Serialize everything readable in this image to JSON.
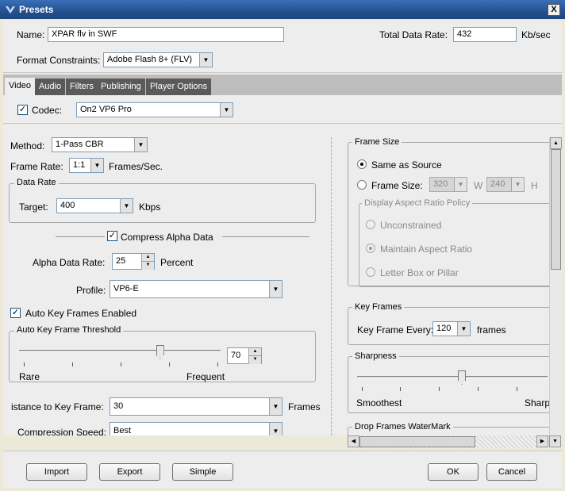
{
  "window": {
    "title": "Presets",
    "close_label": "X"
  },
  "top": {
    "name_label": "Name:",
    "name_value": "XPAR flv in SWF",
    "rate_label": "Total Data Rate:",
    "rate_value": "432",
    "rate_unit": "Kb/sec",
    "format_label": "Format Constraints:",
    "format_value": "Adobe Flash 8+ (FLV)"
  },
  "tabs": [
    "Video",
    "Audio",
    "Filters",
    "Publishing",
    "Player Options"
  ],
  "codec": {
    "label": "Codec:",
    "value": "On2 VP6 Pro",
    "checked": true
  },
  "left": {
    "method_label": "Method:",
    "method_value": "1-Pass CBR",
    "framerate_label": "Frame Rate:",
    "framerate_value": "1:1",
    "framerate_unit": "Frames/Sec.",
    "datarate_group": "Data Rate",
    "target_label": "Target:",
    "target_value": "400",
    "target_unit": "Kbps",
    "compress_alpha_label": "Compress Alpha Data",
    "alpha_rate_label": "Alpha Data Rate:",
    "alpha_rate_value": "25",
    "alpha_rate_unit": "Percent",
    "profile_label": "Profile:",
    "profile_value": "VP6-E",
    "auto_key_label": "Auto Key Frames Enabled",
    "threshold_group": "Auto Key Frame Threshold",
    "threshold_value": "70",
    "threshold_level": 0.7,
    "rare_label": "Rare",
    "frequent_label": "Frequent",
    "distance_label": "istance to Key Frame:",
    "distance_value": "30",
    "distance_unit": "Frames",
    "speed_label": "Compression Speed:",
    "speed_value": "Best"
  },
  "right": {
    "framesize_group": "Frame Size",
    "same_as_source": "Same as Source",
    "frame_size_label": "Frame Size:",
    "width_value": "320",
    "w_label": "W",
    "height_value": "240",
    "h_label": "H",
    "policy_group": "Display Aspect Ratio Policy",
    "unconstrained": "Unconstrained",
    "maintain": "Maintain Aspect Ratio",
    "letterbox": "Letter Box or Pillar",
    "keyframes_group": "Key Frames",
    "key_every_label": "Key Frame Every:",
    "key_every_value": "120",
    "key_every_unit": "frames",
    "sharpness_group": "Sharpness",
    "smoothest": "Smoothest",
    "sharpest": "Sharpe",
    "sharpness_level": 0.55,
    "watermark_group": "Drop Frames WaterMark"
  },
  "buttons": {
    "import": "Import",
    "export": "Export",
    "simple": "Simple",
    "ok": "OK",
    "cancel": "Cancel"
  }
}
